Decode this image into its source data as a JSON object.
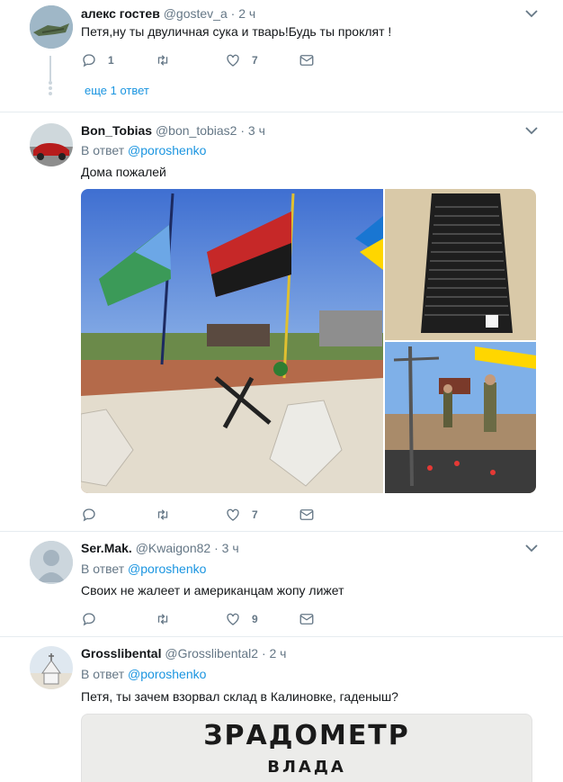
{
  "tweets": [
    {
      "name": "алекс гостев",
      "handle": "@gostev_a",
      "time": "· 2 ч",
      "text": "Петя,ну ты двуличная сука и тварь!Будь ты проклят !",
      "replies": "1",
      "likes": "7",
      "more_replies": "еще 1 ответ"
    },
    {
      "name": "Bon_Tobias",
      "handle": "@bon_tobias2",
      "time": "· 3 ч",
      "reply_prefix": "В ответ",
      "reply_user": "@poroshenko",
      "text": "Дома пожалей",
      "likes": "7"
    },
    {
      "name": "Ser.Mak.",
      "handle": "@Kwaigon82",
      "time": "· 3 ч",
      "reply_prefix": "В ответ",
      "reply_user": "@poroshenko",
      "text": "Своих не жалеет и американцам жопу лижет",
      "likes": "9"
    },
    {
      "name": "Grosslibental",
      "handle": "@Grosslibental2",
      "time": "· 2 ч",
      "reply_prefix": "В ответ",
      "reply_user": "@poroshenko",
      "text": "Петя, ты зачем взорвал склад в Калиновке, гаденыш?",
      "image_title": "ЗРАДОМЕТР",
      "image_subtitle": "ВЛАДА"
    }
  ],
  "colors": {
    "accent": "#1b95e0",
    "muted": "#657786",
    "divider": "#e6ecf0"
  },
  "icons": [
    "reply-icon",
    "retweet-icon",
    "like-icon",
    "message-icon",
    "chevron-down-icon"
  ]
}
